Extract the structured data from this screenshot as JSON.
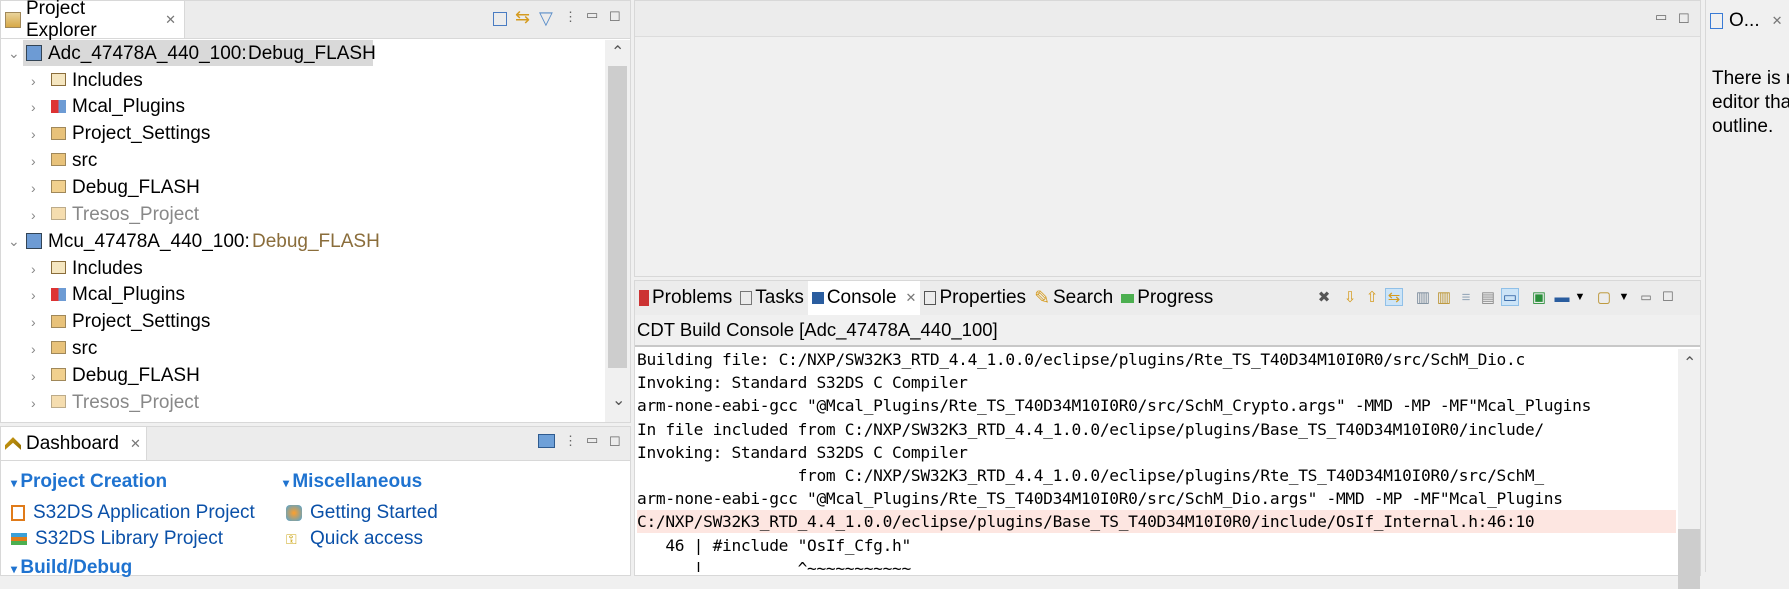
{
  "project_explorer": {
    "tab_label": "Project Explorer",
    "projects": [
      {
        "name": "Adc_47478A_440_100:",
        "config": "Debug_FLASH",
        "selected": true,
        "children": [
          "Includes",
          "Mcal_Plugins",
          "Project_Settings",
          "src",
          "Debug_FLASH",
          "Tresos_Project"
        ]
      },
      {
        "name": "Mcu_47478A_440_100:",
        "config": "Debug_FLASH",
        "selected": false,
        "children": [
          "Includes",
          "Mcal_Plugins",
          "Project_Settings",
          "src",
          "Debug_FLASH",
          "Tresos_Project"
        ]
      }
    ]
  },
  "dashboard": {
    "tab_label": "Dashboard",
    "sections": [
      {
        "title": "Project Creation",
        "links": [
          "S32DS Application Project",
          "S32DS Library Project"
        ]
      },
      {
        "title": "Miscellaneous",
        "links": [
          "Getting Started",
          "Quick access"
        ]
      },
      {
        "title": "Build/Debug",
        "links": []
      }
    ]
  },
  "bottom_panel": {
    "tabs": [
      "Problems",
      "Tasks",
      "Console",
      "Properties",
      "Search",
      "Progress"
    ],
    "active_tab": "Console",
    "console_title": "CDT Build Console [Adc_47478A_440_100]",
    "lines": [
      "Building file: C:/NXP/SW32K3_RTD_4.4_1.0.0/eclipse/plugins/Rte_TS_T40D34M10I0R0/src/SchM_Dio.c",
      "Invoking: Standard S32DS C Compiler",
      "arm-none-eabi-gcc \"@Mcal_Plugins/Rte_TS_T40D34M10I0R0/src/SchM_Crypto.args\" -MMD -MP -MF\"Mcal_Plugins",
      "In file included from C:/NXP/SW32K3_RTD_4.4_1.0.0/eclipse/plugins/Base_TS_T40D34M10I0R0/include/",
      "Invoking: Standard S32DS C Compiler",
      "                 from C:/NXP/SW32K3_RTD_4.4_1.0.0/eclipse/plugins/Rte_TS_T40D34M10I0R0/src/SchM_",
      "arm-none-eabi-gcc \"@Mcal_Plugins/Rte_TS_T40D34M10I0R0/src/SchM_Dio.args\" -MMD -MP -MF\"Mcal_Plugins",
      "C:/NXP/SW32K3_RTD_4.4_1.0.0/eclipse/plugins/Base_TS_T40D34M10I0R0/include/OsIf_Internal.h:46:10",
      "   46 | #include \"OsIf_Cfg.h\"",
      "      |          ^~~~~~~~~~~~"
    ],
    "error_line_index": 7
  },
  "outline": {
    "tab_label": "O...",
    "message_lines": [
      "There is n",
      "editor tha",
      "outline."
    ]
  },
  "colors": {
    "link": "#0a50a8",
    "section": "#1f73d0",
    "error_bg": "#fde6e1",
    "selected_bg": "#d9d9d9",
    "config_grey": "#8a6d3b"
  }
}
